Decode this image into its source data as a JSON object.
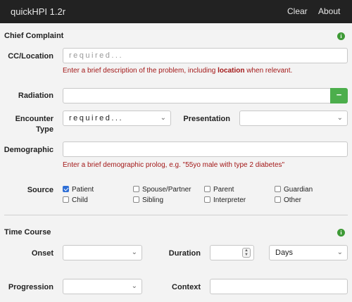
{
  "app": {
    "title": "quickHPI 1.2r",
    "nav": {
      "clear": "Clear",
      "about": "About"
    }
  },
  "chief_complaint": {
    "title": "Chief Complaint",
    "cc_location": {
      "label": "CC/Location",
      "placeholder": "required...",
      "help_before": "Enter a brief description of the problem, including ",
      "help_bold": "location",
      "help_after": " when relevant."
    },
    "radiation": {
      "label": "Radiation",
      "value": "",
      "remove_label": "−"
    },
    "encounter_type": {
      "label_line1": "Encounter",
      "label_line2": "Type",
      "value": "required..."
    },
    "presentation": {
      "label": "Presentation",
      "value": ""
    },
    "demographic": {
      "label": "Demographic",
      "value": "",
      "help": "Enter a brief demographic prolog, e.g. \"55yo male with type 2 diabetes\""
    },
    "source": {
      "label": "Source",
      "options": [
        {
          "label": "Patient",
          "checked": true
        },
        {
          "label": "Spouse/Partner",
          "checked": false
        },
        {
          "label": "Parent",
          "checked": false
        },
        {
          "label": "Guardian",
          "checked": false
        },
        {
          "label": "Child",
          "checked": false
        },
        {
          "label": "Sibling",
          "checked": false
        },
        {
          "label": "Interpreter",
          "checked": false
        },
        {
          "label": "Other",
          "checked": false
        }
      ]
    }
  },
  "time_course": {
    "title": "Time Course",
    "onset": {
      "label": "Onset",
      "value": ""
    },
    "duration": {
      "label": "Duration",
      "value": "",
      "unit": "Days"
    },
    "progression": {
      "label": "Progression",
      "value": ""
    },
    "context": {
      "label": "Context",
      "value": ""
    }
  },
  "icons": {
    "info": "info-icon",
    "chevron": "chevron-down-icon",
    "check": "check-icon"
  },
  "colors": {
    "navbar": "#222222",
    "help_text": "#a31818",
    "success": "#4cae4c",
    "checkbox": "#2f6fd6"
  }
}
